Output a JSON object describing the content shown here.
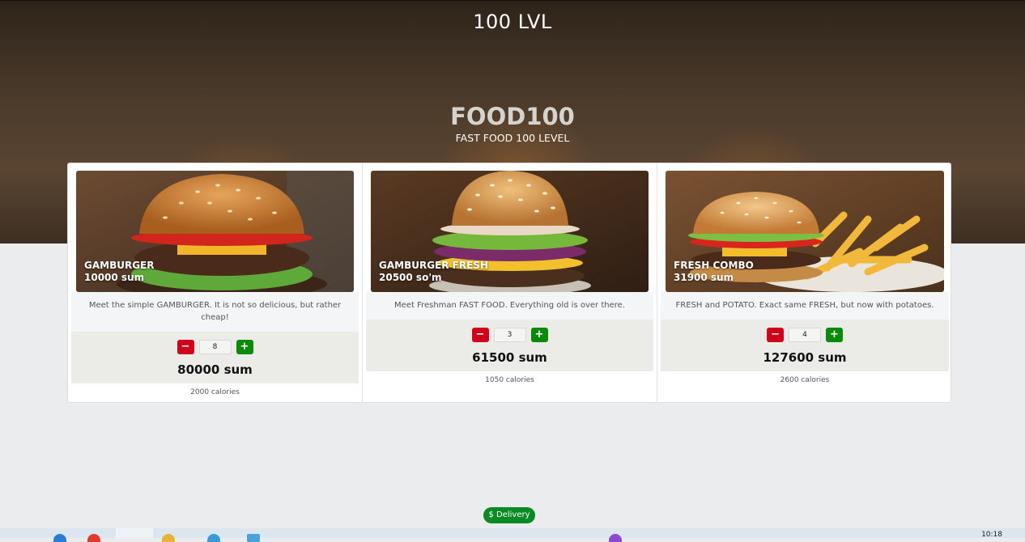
{
  "header": {
    "site_title": "100 LVL",
    "brand": "FOOD100",
    "tagline": "FAST FOOD 100 LEVEL"
  },
  "products": [
    {
      "name": "GAMBURGER",
      "photo_price": "10000 sum",
      "description": "Meet the simple GAMBURGER. It is not so delicious, but rather cheap!",
      "quantity": "8",
      "total": "80000 sum",
      "calories": "2000 calories"
    },
    {
      "name": "GAMBURGER FRESH",
      "photo_price": "20500 so'm",
      "description": "Meet Freshman FAST FOOD. Everything old is over there.",
      "quantity": "3",
      "total": "61500 sum",
      "calories": "1050 calories"
    },
    {
      "name": "FRESH COMBO",
      "photo_price": "31900 sum",
      "description": "FRESH and POTATO. Exact same FRESH, but now with potatoes.",
      "quantity": "4",
      "total": "127600 sum",
      "calories": "2600 calories"
    }
  ],
  "controls": {
    "minus_label": "−",
    "plus_label": "+"
  },
  "delivery": {
    "label": "$ Delivery"
  },
  "taskbar": {
    "clock": "10:18"
  },
  "colors": {
    "minus": "#d0021b",
    "plus": "#0a8a0a",
    "delivery": "#0a8a24"
  },
  "icons": [
    "burger-photo",
    "burger-fresh-photo",
    "combo-photo"
  ]
}
